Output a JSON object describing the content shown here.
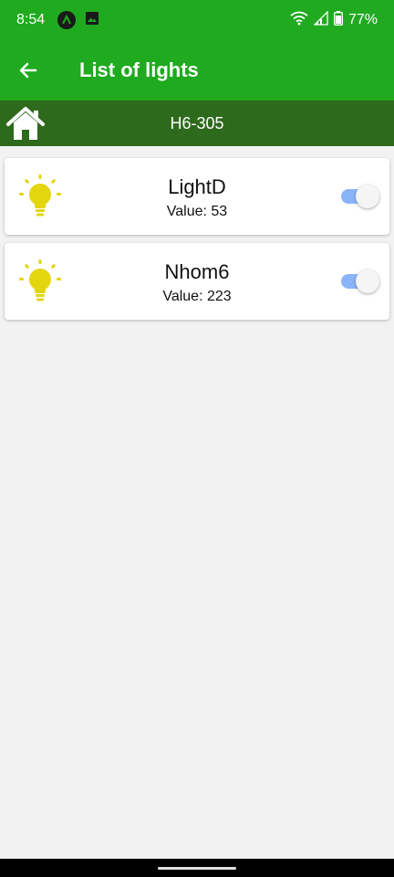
{
  "status_bar": {
    "time": "8:54",
    "battery": "77%",
    "icons": [
      "app-a-icon",
      "gallery-icon",
      "wifi-icon",
      "signal-icon",
      "battery-icon"
    ]
  },
  "app_bar": {
    "title": "List of lights",
    "back_icon": "arrow-left-icon"
  },
  "room": {
    "name": "H6-305",
    "icon": "home-icon"
  },
  "lights": [
    {
      "name": "LightD",
      "value_label": "Value: 53",
      "on": true,
      "icon": "lightbulb-icon"
    },
    {
      "name": "Nhom6",
      "value_label": "Value: 223",
      "on": true,
      "icon": "lightbulb-icon"
    }
  ],
  "colors": {
    "app_bar": "#1faa1f",
    "room_bar": "#2e6a1c",
    "bulb": "#e3d60f",
    "toggle_track": "#8ab4f8",
    "background": "#f2f2f2"
  }
}
